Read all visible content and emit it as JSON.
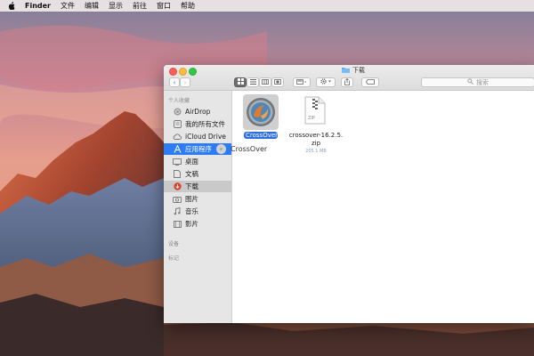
{
  "menubar": {
    "items": [
      "Finder",
      "文件",
      "编辑",
      "显示",
      "前往",
      "窗口",
      "帮助"
    ]
  },
  "window": {
    "title": "下载",
    "search_placeholder": "搜索"
  },
  "sidebar": {
    "favorites_header": "个人收藏",
    "items": [
      {
        "label": "AirDrop",
        "icon": "airdrop-icon"
      },
      {
        "label": "我的所有文件",
        "icon": "all-files-icon"
      },
      {
        "label": "iCloud Drive",
        "icon": "cloud-icon"
      },
      {
        "label": "应用程序",
        "icon": "applications-icon"
      },
      {
        "label": "桌面",
        "icon": "desktop-icon"
      },
      {
        "label": "文稿",
        "icon": "documents-icon"
      },
      {
        "label": "下载",
        "icon": "downloads-icon"
      },
      {
        "label": "图片",
        "icon": "pictures-icon"
      },
      {
        "label": "音乐",
        "icon": "music-icon"
      },
      {
        "label": "影片",
        "icon": "movies-icon"
      }
    ],
    "devices_header": "设备",
    "tags_header": "标记"
  },
  "files": [
    {
      "name": "CrossOver",
      "icon": "crossover-app-icon"
    },
    {
      "name_line1": "crossover-16.2.5.",
      "name_line2": "zip",
      "size": "205.1 MB",
      "badge": "ZIP",
      "icon": "zip-file-icon"
    }
  ],
  "drag_label": "CrossOver",
  "colors": {
    "selection": "#2c7df5",
    "downloads_badge": "#d9442c"
  }
}
